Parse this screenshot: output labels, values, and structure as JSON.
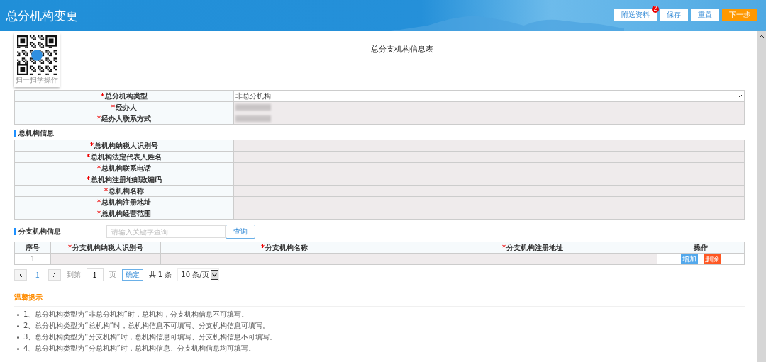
{
  "header": {
    "title": "总分机构变更",
    "buttons": [
      {
        "label": "附送资料",
        "badge": "2",
        "kind": "plain"
      },
      {
        "label": "保存",
        "kind": "plain"
      },
      {
        "label": "重置",
        "kind": "plain"
      },
      {
        "label": "下一步",
        "kind": "primary"
      }
    ]
  },
  "qr": {
    "caption": "扫一扫学操作"
  },
  "form_title": "总分支机构信息表",
  "basic_fields": [
    {
      "label": "总分机构类型",
      "required": true,
      "kind": "select",
      "value": "非总分机构"
    },
    {
      "label": "经办人",
      "required": true,
      "kind": "masked"
    },
    {
      "label": "经办人联系方式",
      "required": true,
      "kind": "masked"
    }
  ],
  "head_office": {
    "title": "总机构信息",
    "fields": [
      {
        "label": "总机构纳税人识别号",
        "required": true,
        "disabled": true
      },
      {
        "label": "总机构法定代表人姓名",
        "required": true,
        "disabled": true
      },
      {
        "label": "总机构联系电话",
        "required": true,
        "disabled": true
      },
      {
        "label": "总机构注册地邮政编码",
        "required": true,
        "disabled": true
      },
      {
        "label": "总机构名称",
        "required": true,
        "disabled": true
      },
      {
        "label": "总机构注册地址",
        "required": true,
        "disabled": true
      },
      {
        "label": "总机构经营范围",
        "required": true,
        "disabled": true
      }
    ]
  },
  "branch": {
    "title": "分支机构信息",
    "search": {
      "placeholder": "请输入关键字查询",
      "button": "查询"
    },
    "columns": [
      {
        "label": "序号",
        "required": false
      },
      {
        "label": "分支机构纳税人识别号",
        "required": true
      },
      {
        "label": "分支机构名称",
        "required": true
      },
      {
        "label": "分支机构注册地址",
        "required": true
      },
      {
        "label": "操作",
        "required": false
      }
    ],
    "rows": [
      {
        "index": "1",
        "disabled": true,
        "actions": [
          {
            "label": "增加",
            "kind": "add"
          },
          {
            "label": "删除",
            "kind": "delete"
          }
        ]
      }
    ]
  },
  "pagination": {
    "pages": [
      {
        "label": "1",
        "selected": true
      }
    ],
    "goto_label": "到第",
    "goto_value": "1",
    "page_unit": "页",
    "confirm": "确定",
    "total": "共 1 条",
    "page_size": "10 条/页"
  },
  "tips": {
    "title": "温馨提示",
    "items": [
      "1、总分机构类型为“非总分机构”时，总机构，分支机构信息不可填写。",
      "2、总分机构类型为“总机构”时，总机构信息不可填写、分支机构信息可填写。",
      "3、总分机构类型为“分支机构”时，总机构信息可填写、分支机构信息不可填写。",
      "4、总分机构类型为“分总机构”时，总机构信息、分支机构信息均可填写。"
    ]
  }
}
